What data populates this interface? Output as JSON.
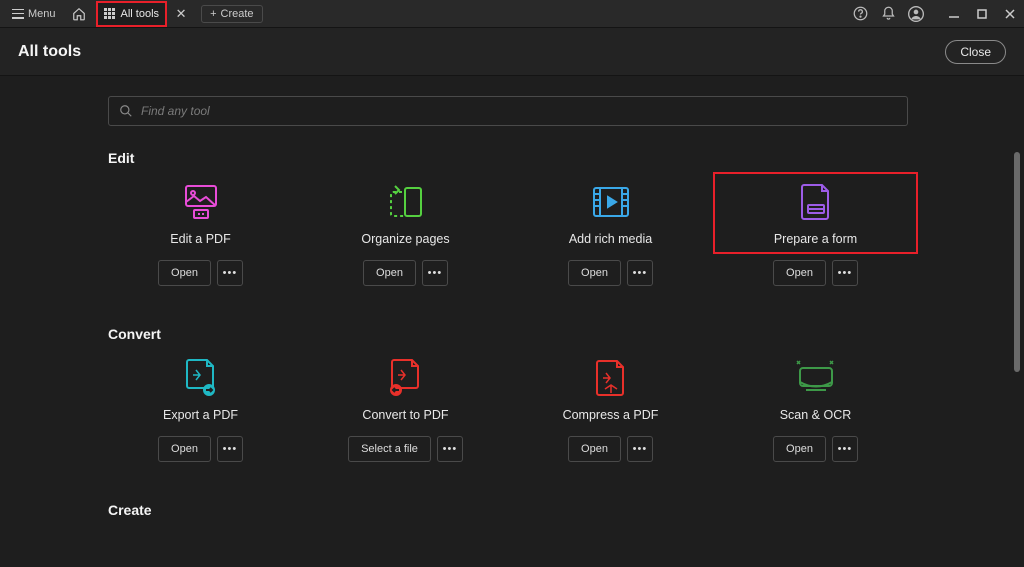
{
  "topbar": {
    "menu_label": "Menu",
    "tab_label": "All tools",
    "create_label": "Create"
  },
  "header": {
    "title": "All tools",
    "close_label": "Close"
  },
  "search": {
    "placeholder": "Find any tool"
  },
  "sections": {
    "edit": {
      "title": "Edit",
      "tools": [
        {
          "label": "Edit a PDF",
          "action": "Open"
        },
        {
          "label": "Organize pages",
          "action": "Open"
        },
        {
          "label": "Add rich media",
          "action": "Open"
        },
        {
          "label": "Prepare a form",
          "action": "Open"
        }
      ]
    },
    "convert": {
      "title": "Convert",
      "tools": [
        {
          "label": "Export a PDF",
          "action": "Open"
        },
        {
          "label": "Convert to PDF",
          "action": "Select a file"
        },
        {
          "label": "Compress a PDF",
          "action": "Open"
        },
        {
          "label": "Scan & OCR",
          "action": "Open"
        }
      ]
    },
    "create": {
      "title": "Create"
    }
  }
}
